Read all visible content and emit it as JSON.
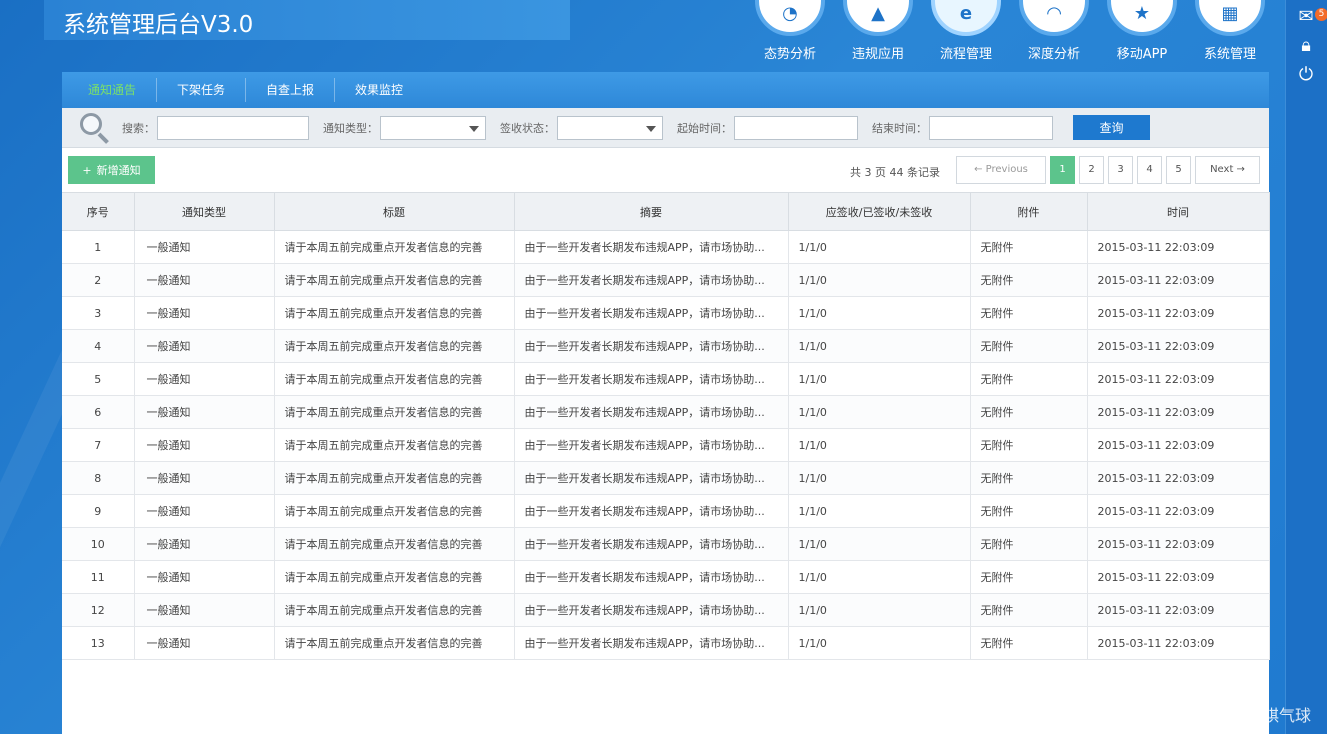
{
  "app": {
    "title": "系统管理后台V3.0"
  },
  "nav": [
    {
      "label": "态势分析",
      "icon": "pie-chart-icon",
      "glyph": "◔"
    },
    {
      "label": "违规应用",
      "icon": "warning-icon",
      "glyph": "▲"
    },
    {
      "label": "流程管理",
      "icon": "browser-e-icon",
      "glyph": "e"
    },
    {
      "label": "深度分析",
      "icon": "gauge-icon",
      "glyph": "◠"
    },
    {
      "label": "移动APP",
      "icon": "shield-star-icon",
      "glyph": "★"
    },
    {
      "label": "系统管理",
      "icon": "dashboard-icon",
      "glyph": "▦"
    }
  ],
  "rail": {
    "mail_badge": "5",
    "icons": [
      "mail-icon",
      "lock-icon",
      "power-icon"
    ]
  },
  "sub_tabs": [
    {
      "label": "通知通告",
      "active": true
    },
    {
      "label": "下架任务",
      "active": false
    },
    {
      "label": "自查上报",
      "active": false
    },
    {
      "label": "效果监控",
      "active": false
    }
  ],
  "search": {
    "keyword_label": "搜索：",
    "keyword_value": "",
    "type_label": "通知类型：",
    "type_value": "",
    "status_label": "签收状态：",
    "status_value": "",
    "start_label": "起始时间：",
    "start_value": "",
    "end_label": "结束时间：",
    "end_value": "",
    "query_button": "查询"
  },
  "actions": {
    "add_button": "新增通知",
    "add_glyph": "+",
    "total_text": "共 3 页 44 条记录"
  },
  "pager": {
    "previous": "← Previous",
    "pages": [
      "1",
      "2",
      "3",
      "4",
      "5"
    ],
    "current": "1",
    "next": "Next →"
  },
  "table": {
    "columns": [
      "序号",
      "通知类型",
      "标题",
      "摘要",
      "应签收/已签收/未签收",
      "附件",
      "时间"
    ],
    "rows": [
      [
        "1",
        "一般通知",
        "请于本周五前完成重点开发者信息的完善",
        "由于一些开发者长期发布违规APP，请市场协助...",
        "1/1/0",
        "无附件",
        "2015-03-11 22:03:09"
      ],
      [
        "2",
        "一般通知",
        "请于本周五前完成重点开发者信息的完善",
        "由于一些开发者长期发布违规APP，请市场协助...",
        "1/1/0",
        "无附件",
        "2015-03-11 22:03:09"
      ],
      [
        "3",
        "一般通知",
        "请于本周五前完成重点开发者信息的完善",
        "由于一些开发者长期发布违规APP，请市场协助...",
        "1/1/0",
        "无附件",
        "2015-03-11 22:03:09"
      ],
      [
        "4",
        "一般通知",
        "请于本周五前完成重点开发者信息的完善",
        "由于一些开发者长期发布违规APP，请市场协助...",
        "1/1/0",
        "无附件",
        "2015-03-11 22:03:09"
      ],
      [
        "5",
        "一般通知",
        "请于本周五前完成重点开发者信息的完善",
        "由于一些开发者长期发布违规APP，请市场协助...",
        "1/1/0",
        "无附件",
        "2015-03-11 22:03:09"
      ],
      [
        "6",
        "一般通知",
        "请于本周五前完成重点开发者信息的完善",
        "由于一些开发者长期发布违规APP，请市场协助...",
        "1/1/0",
        "无附件",
        "2015-03-11 22:03:09"
      ],
      [
        "7",
        "一般通知",
        "请于本周五前完成重点开发者信息的完善",
        "由于一些开发者长期发布违规APP，请市场协助...",
        "1/1/0",
        "无附件",
        "2015-03-11 22:03:09"
      ],
      [
        "8",
        "一般通知",
        "请于本周五前完成重点开发者信息的完善",
        "由于一些开发者长期发布违规APP，请市场协助...",
        "1/1/0",
        "无附件",
        "2015-03-11 22:03:09"
      ],
      [
        "9",
        "一般通知",
        "请于本周五前完成重点开发者信息的完善",
        "由于一些开发者长期发布违规APP，请市场协助...",
        "1/1/0",
        "无附件",
        "2015-03-11 22:03:09"
      ],
      [
        "10",
        "一般通知",
        "请于本周五前完成重点开发者信息的完善",
        "由于一些开发者长期发布违规APP，请市场协助...",
        "1/1/0",
        "无附件",
        "2015-03-11 22:03:09"
      ],
      [
        "11",
        "一般通知",
        "请于本周五前完成重点开发者信息的完善",
        "由于一些开发者长期发布违规APP，请市场协助...",
        "1/1/0",
        "无附件",
        "2015-03-11 22:03:09"
      ],
      [
        "12",
        "一般通知",
        "请于本周五前完成重点开发者信息的完善",
        "由于一些开发者长期发布违规APP，请市场协助...",
        "1/1/0",
        "无附件",
        "2015-03-11 22:03:09"
      ],
      [
        "13",
        "一般通知",
        "请于本周五前完成重点开发者信息的完善",
        "由于一些开发者长期发布违规APP，请市场协助...",
        "1/1/0",
        "无附件",
        "2015-03-11 22:03:09"
      ]
    ]
  },
  "watermark": "CSDN @氽星星祺气球",
  "colors": {
    "background": "#1f7ad0",
    "accent": "#1e79cf",
    "green": "#5cc48c",
    "active_tab": "#7be06a",
    "badge": "#f26b2a"
  }
}
